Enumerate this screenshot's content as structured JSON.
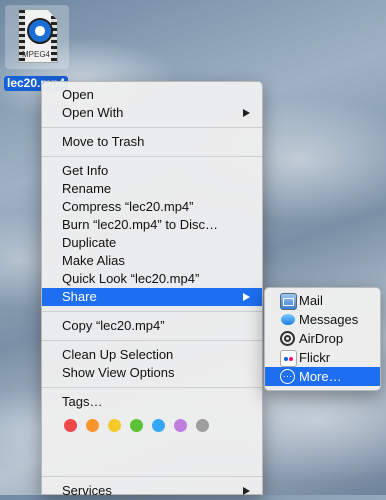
{
  "desktop": {
    "file_name": "lec20.mp4",
    "file_kind_label": "MPEG4",
    "file_icon": "quicktime-movie-icon"
  },
  "menu": {
    "group1": [
      "Open",
      "Open With"
    ],
    "group2": [
      "Move to Trash"
    ],
    "group3": [
      "Get Info",
      "Rename",
      "Compress “lec20.mp4”",
      "Burn “lec20.mp4” to Disc…",
      "Duplicate",
      "Make Alias",
      "Quick Look “lec20.mp4”",
      "Share"
    ],
    "group4": [
      "Copy “lec20.mp4”"
    ],
    "group5": [
      "Clean Up Selection",
      "Show View Options"
    ],
    "tags_label": "Tags…",
    "tag_colors": [
      "#f0474a",
      "#f7962e",
      "#f6c92a",
      "#5bc236",
      "#35a6f5",
      "#c07fe0",
      "#9e9e9e"
    ],
    "services": "Services",
    "selected_item": "Share",
    "selection_color": "#1d6ef0"
  },
  "share_submenu": {
    "items": [
      "Mail",
      "Messages",
      "AirDrop",
      "Flickr",
      "More…"
    ],
    "icons": [
      "mail-icon",
      "messages-icon",
      "airdrop-icon",
      "flickr-icon",
      "more-icon"
    ],
    "selected_item": "More…"
  }
}
